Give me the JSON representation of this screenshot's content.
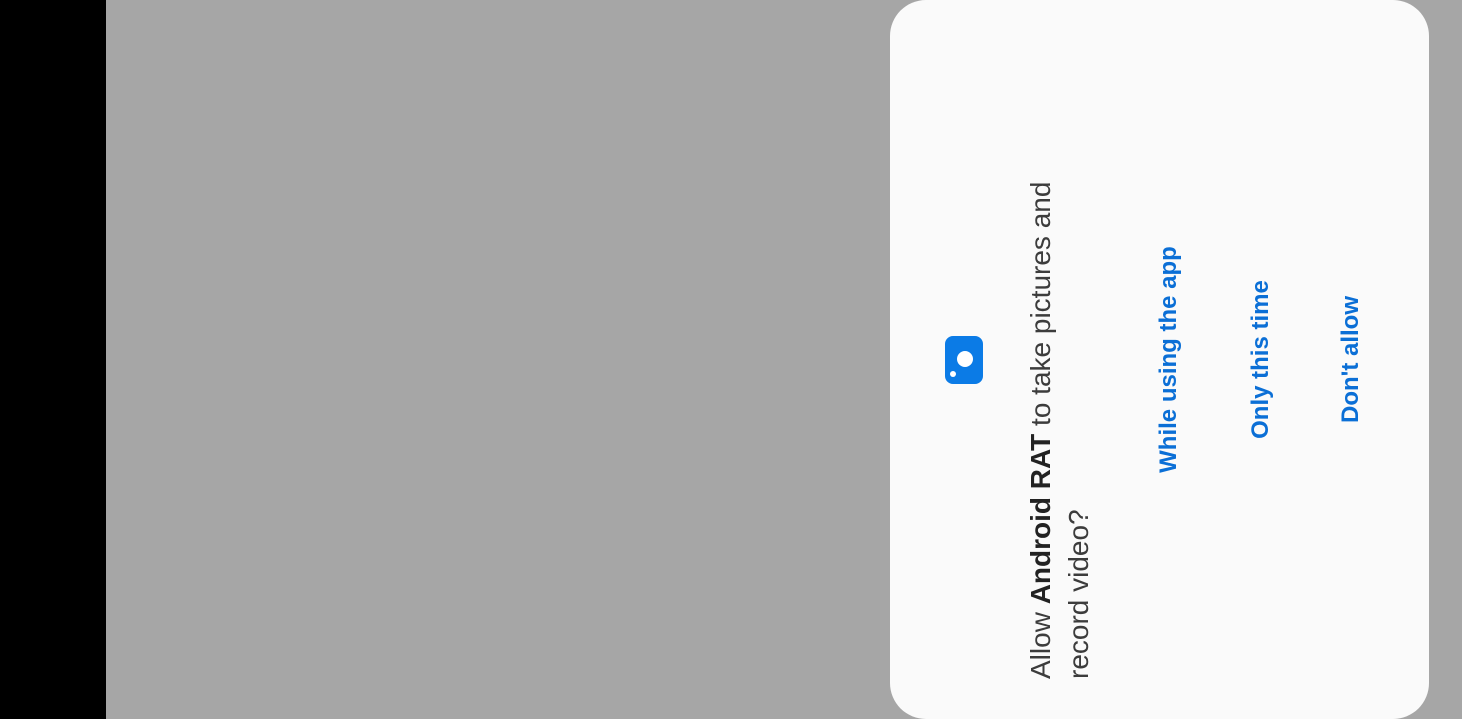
{
  "permission_dialog": {
    "message_prefix": "Allow ",
    "app_name": "Android RAT",
    "message_suffix": " to take pictures and record video?",
    "icon": "camera-icon",
    "buttons": {
      "while_using": "While using the app",
      "only_this_time": "Only this time",
      "dont_allow": "Don't allow"
    }
  },
  "colors": {
    "accent": "#0b7be6",
    "scrim": "#a6a6a6",
    "dialog_bg": "#fafafa"
  }
}
